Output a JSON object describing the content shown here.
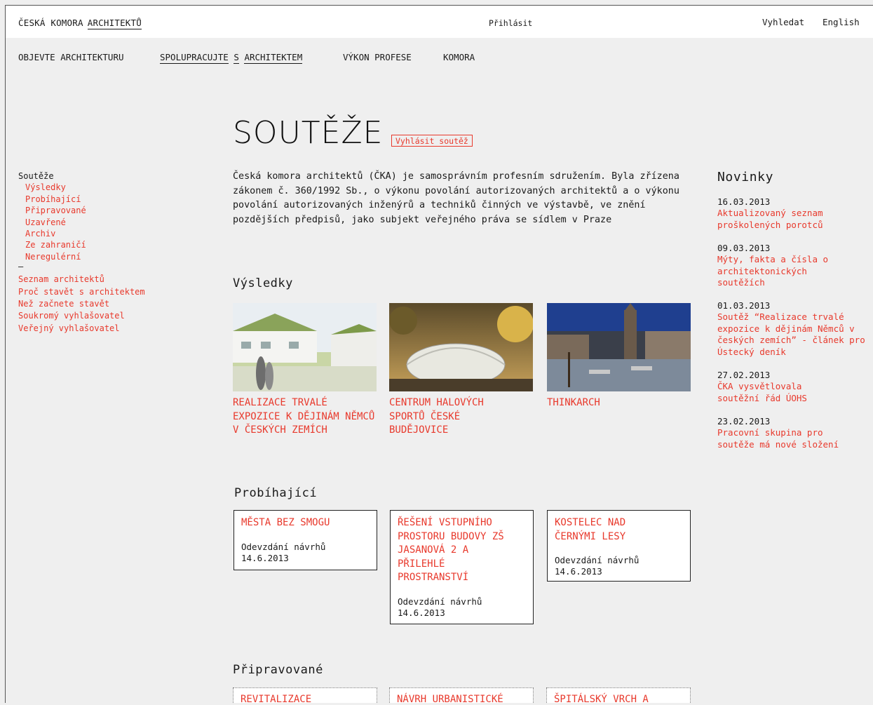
{
  "header": {
    "brand_part1": "ČESKÁ KOMORA",
    "brand_part2": "ARCHITEKTŮ",
    "login": "Přihlásit",
    "search": "Vyhledat",
    "language": "English"
  },
  "nav": [
    {
      "label": "OBJEVTE ARCHITEKTURU"
    },
    {
      "label_a": "SPOLUPRACUJTE",
      "label_b": "S",
      "label_c": "ARCHITEKTEM"
    },
    {
      "label": "VÝKON PROFESE"
    },
    {
      "label": "KOMORA"
    }
  ],
  "page": {
    "title": "SOUTĚŽE",
    "announce_button": "Vyhlásit soutěž",
    "intro": "Česká komora architektů (ČKA) je samosprávním profesním sdružením. Byla zřízena zákonem č. 360/1992 Sb., o výkonu povolání autorizovaných architektů a o výkonu povolání autorizovaných inženýrů a techniků činných ve výstavbě, ve znění pozdějších předpisů, jako subjekt veřejného práva se sídlem v Praze"
  },
  "sidebar": {
    "heading": "Soutěže",
    "sub_items": [
      "Výsledky",
      "Probíhající",
      "Připravované",
      "Uzavřené",
      "Archiv",
      "Ze zahraničí",
      "Neregulérní"
    ],
    "separator": "–",
    "links": [
      "Seznam architektů",
      "Proč stavět s architektem",
      "Než začnete stavět",
      "Soukromý vyhlašovatel",
      "Veřejný vyhlašovatel"
    ]
  },
  "results": {
    "title": "Výsledky",
    "items": [
      {
        "title": "REALIZACE TRVALÉ EXPOZICE K DĚJINÁM NĚMCŮ V ČESKÝCH ZEMÍCH"
      },
      {
        "title": "CENTRUM HALOVÝCH SPORTŮ ČESKÉ BUDĚJOVICE"
      },
      {
        "title": "THINKARCH"
      }
    ]
  },
  "ongoing": {
    "title": "Probíhající",
    "items": [
      {
        "title": "MĚSTA BEZ SMOGU",
        "deadline_label": "Odevzdání návrhů",
        "deadline": "14.6.2013"
      },
      {
        "title": "ŘEŠENÍ VSTUPNÍHO PROSTORU BUDOVY ZŠ JASANOVÁ 2 A PŘILEHLÉ PROSTRANSTVÍ",
        "deadline_label": "Odevzdání návrhů",
        "deadline": "14.6.2013"
      },
      {
        "title": "KOSTELEC NAD ČERNÝMI LESY",
        "deadline_label": "Odevzdání návrhů",
        "deadline": "14.6.2013"
      }
    ]
  },
  "upcoming": {
    "title": "Připravované",
    "items": [
      {
        "title": "REVITALIZACE"
      },
      {
        "title": "NÁVRH URBANISTICKÉ"
      },
      {
        "title": "ŠPITÁLSKÝ VRCH A"
      }
    ]
  },
  "news": {
    "title": "Novinky",
    "items": [
      {
        "date": "16.03.2013",
        "text": "Aktualizovaný seznam proškolených porotců"
      },
      {
        "date": "09.03.2013",
        "text": "Mýty, fakta a čísla o architektonických soutěžích"
      },
      {
        "date": "01.03.2013",
        "text": "Soutěž “Realizace trvalé expozice k dějinám Němců v českých zemích” - článek pro Ústecký deník"
      },
      {
        "date": "27.02.2013",
        "text": "ČKA vysvětlovala soutěžní řád ÚOHS"
      },
      {
        "date": "23.02.2013",
        "text": "Pracovní skupina pro soutěže má nové složení"
      }
    ]
  },
  "colors": {
    "accent": "#e8392c",
    "background": "#efefef",
    "text": "#1a1a1a"
  }
}
